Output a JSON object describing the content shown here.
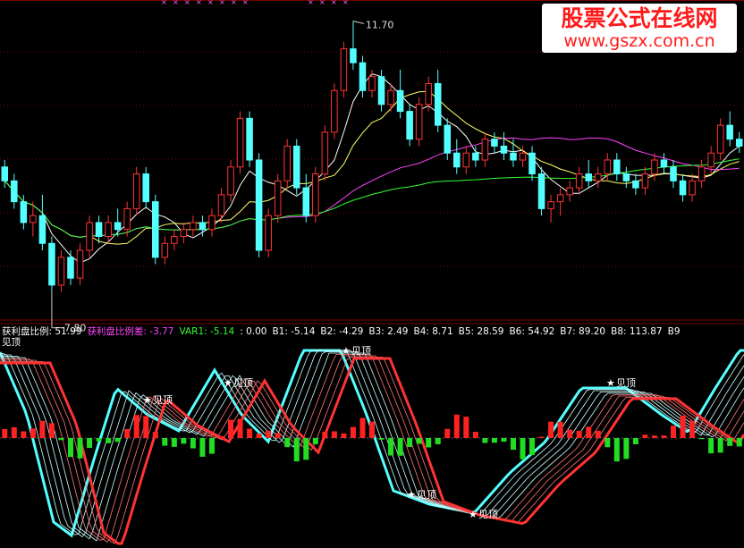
{
  "watermark": {
    "title": "股票公式在线网",
    "url": "www.gszx.com.cn"
  },
  "colors": {
    "up": "#ff3333",
    "down": "#54ffff",
    "ma5": "#ffffff",
    "ma10": "#ffff66",
    "ma30": "#ff44ff",
    "ma60": "#33ff33",
    "grid_red": "#7a0000",
    "label_yellow": "#ffff00"
  },
  "price_panel": {
    "high_label": "11.70",
    "low_label": "7.80"
  },
  "indicator_panel": {
    "row_marker": "三",
    "legend": [
      {
        "text": "获利盘比例: 51.99",
        "color": "#ffffff"
      },
      {
        "text": "获利盘比例差: -3.77",
        "color": "#ff44ff"
      },
      {
        "text": "VAR1: -5.14",
        "color": "#33ff33"
      },
      {
        "text": ": 0.00",
        "color": "#ffffff"
      },
      {
        "text": "B1: -5.14",
        "color": "#ffffff"
      },
      {
        "text": "B2: -4.29",
        "color": "#ffffff"
      },
      {
        "text": "B3: 2.49",
        "color": "#ffffff"
      },
      {
        "text": "B4: 8.71",
        "color": "#ffffff"
      },
      {
        "text": "B5: 28.59",
        "color": "#ffffff"
      },
      {
        "text": "B6: 54.92",
        "color": "#ffffff"
      },
      {
        "text": "B7: 89.20",
        "color": "#ffffff"
      },
      {
        "text": "B8: 113.87",
        "color": "#ffffff"
      },
      {
        "text": "B9",
        "color": "#ffffff"
      }
    ],
    "annotation_label": "见顶",
    "corner_label": "见顶"
  },
  "chart_data": [
    {
      "type": "candlestick",
      "title": "",
      "xlabel": "",
      "ylabel": "",
      "ylim": [
        7.5,
        11.9
      ],
      "price_high": 11.7,
      "price_low": 7.8,
      "ohlc": [
        [
          9.6,
          9.7,
          9.3,
          9.4
        ],
        [
          9.4,
          9.5,
          9.0,
          9.1
        ],
        [
          9.1,
          9.2,
          8.7,
          8.8
        ],
        [
          8.8,
          9.1,
          8.6,
          8.9
        ],
        [
          8.9,
          9.2,
          8.4,
          8.5
        ],
        [
          8.5,
          8.6,
          7.8,
          7.9
        ],
        [
          7.9,
          8.4,
          7.8,
          8.3
        ],
        [
          8.3,
          8.4,
          7.9,
          8.0
        ],
        [
          8.0,
          8.5,
          7.9,
          8.4
        ],
        [
          8.4,
          8.9,
          8.3,
          8.8
        ],
        [
          8.8,
          8.9,
          8.5,
          8.6
        ],
        [
          8.6,
          8.9,
          8.5,
          8.8
        ],
        [
          8.8,
          9.0,
          8.6,
          8.7
        ],
        [
          8.7,
          9.1,
          8.6,
          9.0
        ],
        [
          9.0,
          9.6,
          8.9,
          9.5
        ],
        [
          9.5,
          9.6,
          9.0,
          9.1
        ],
        [
          9.1,
          9.2,
          8.2,
          8.3
        ],
        [
          8.3,
          8.6,
          8.2,
          8.5
        ],
        [
          8.5,
          8.7,
          8.4,
          8.6
        ],
        [
          8.6,
          8.8,
          8.5,
          8.7
        ],
        [
          8.7,
          8.9,
          8.6,
          8.8
        ],
        [
          8.8,
          8.9,
          8.6,
          8.7
        ],
        [
          8.7,
          9.0,
          8.6,
          8.9
        ],
        [
          8.9,
          9.3,
          8.8,
          9.2
        ],
        [
          9.2,
          9.7,
          9.1,
          9.6
        ],
        [
          9.6,
          10.4,
          9.5,
          10.3
        ],
        [
          10.3,
          10.4,
          9.6,
          9.7
        ],
        [
          9.7,
          9.8,
          8.3,
          8.4
        ],
        [
          8.4,
          9.0,
          8.3,
          8.9
        ],
        [
          8.9,
          9.5,
          8.8,
          9.4
        ],
        [
          9.4,
          10.0,
          9.3,
          9.9
        ],
        [
          9.9,
          10.0,
          9.2,
          9.3
        ],
        [
          9.3,
          9.5,
          8.8,
          8.9
        ],
        [
          8.9,
          9.6,
          8.8,
          9.5
        ],
        [
          9.5,
          10.2,
          9.4,
          10.1
        ],
        [
          10.1,
          10.8,
          10.0,
          10.7
        ],
        [
          10.7,
          11.4,
          10.6,
          11.3
        ],
        [
          11.3,
          11.7,
          11.0,
          11.1
        ],
        [
          11.1,
          11.2,
          10.6,
          10.7
        ],
        [
          10.7,
          11.0,
          10.6,
          10.9
        ],
        [
          10.9,
          11.0,
          10.4,
          10.5
        ],
        [
          10.5,
          10.8,
          10.4,
          10.7
        ],
        [
          10.7,
          11.0,
          10.3,
          10.4
        ],
        [
          10.4,
          10.5,
          9.9,
          10.0
        ],
        [
          10.0,
          10.6,
          9.9,
          10.5
        ],
        [
          10.5,
          10.9,
          10.4,
          10.8
        ],
        [
          10.8,
          11.0,
          10.1,
          10.2
        ],
        [
          10.2,
          10.3,
          9.7,
          9.8
        ],
        [
          9.8,
          10.0,
          9.5,
          9.6
        ],
        [
          9.6,
          9.9,
          9.5,
          9.8
        ],
        [
          9.8,
          9.9,
          9.6,
          9.7
        ],
        [
          9.7,
          10.1,
          9.6,
          10.0
        ],
        [
          10.0,
          10.1,
          9.8,
          9.9
        ],
        [
          9.9,
          10.1,
          9.7,
          9.8
        ],
        [
          9.8,
          10.0,
          9.6,
          9.7
        ],
        [
          9.7,
          9.9,
          9.6,
          9.8
        ],
        [
          9.8,
          9.9,
          9.4,
          9.5
        ],
        [
          9.5,
          9.6,
          8.9,
          9.0
        ],
        [
          9.0,
          9.2,
          8.8,
          9.1
        ],
        [
          9.1,
          9.3,
          8.9,
          9.2
        ],
        [
          9.2,
          9.4,
          9.1,
          9.3
        ],
        [
          9.3,
          9.6,
          9.2,
          9.5
        ],
        [
          9.5,
          9.7,
          9.3,
          9.4
        ],
        [
          9.4,
          9.6,
          9.3,
          9.5
        ],
        [
          9.5,
          9.8,
          9.4,
          9.7
        ],
        [
          9.7,
          9.8,
          9.4,
          9.5
        ],
        [
          9.5,
          9.6,
          9.3,
          9.4
        ],
        [
          9.4,
          9.5,
          9.2,
          9.3
        ],
        [
          9.3,
          9.6,
          9.2,
          9.5
        ],
        [
          9.5,
          9.8,
          9.4,
          9.7
        ],
        [
          9.7,
          9.8,
          9.5,
          9.6
        ],
        [
          9.6,
          9.7,
          9.3,
          9.4
        ],
        [
          9.4,
          9.5,
          9.1,
          9.2
        ],
        [
          9.2,
          9.5,
          9.1,
          9.4
        ],
        [
          9.4,
          9.7,
          9.3,
          9.6
        ],
        [
          9.6,
          9.9,
          9.5,
          9.8
        ],
        [
          9.8,
          10.3,
          9.7,
          10.2
        ],
        [
          10.2,
          10.4,
          9.9,
          10.0
        ],
        [
          10.0,
          10.1,
          9.8,
          9.9
        ]
      ]
    },
    {
      "type": "line",
      "title": "",
      "series": [],
      "ylim": [
        -100,
        100
      ],
      "annotations": [
        "见顶",
        "见顶",
        "见顶",
        "见顶",
        "见顶",
        "见顶"
      ]
    }
  ]
}
